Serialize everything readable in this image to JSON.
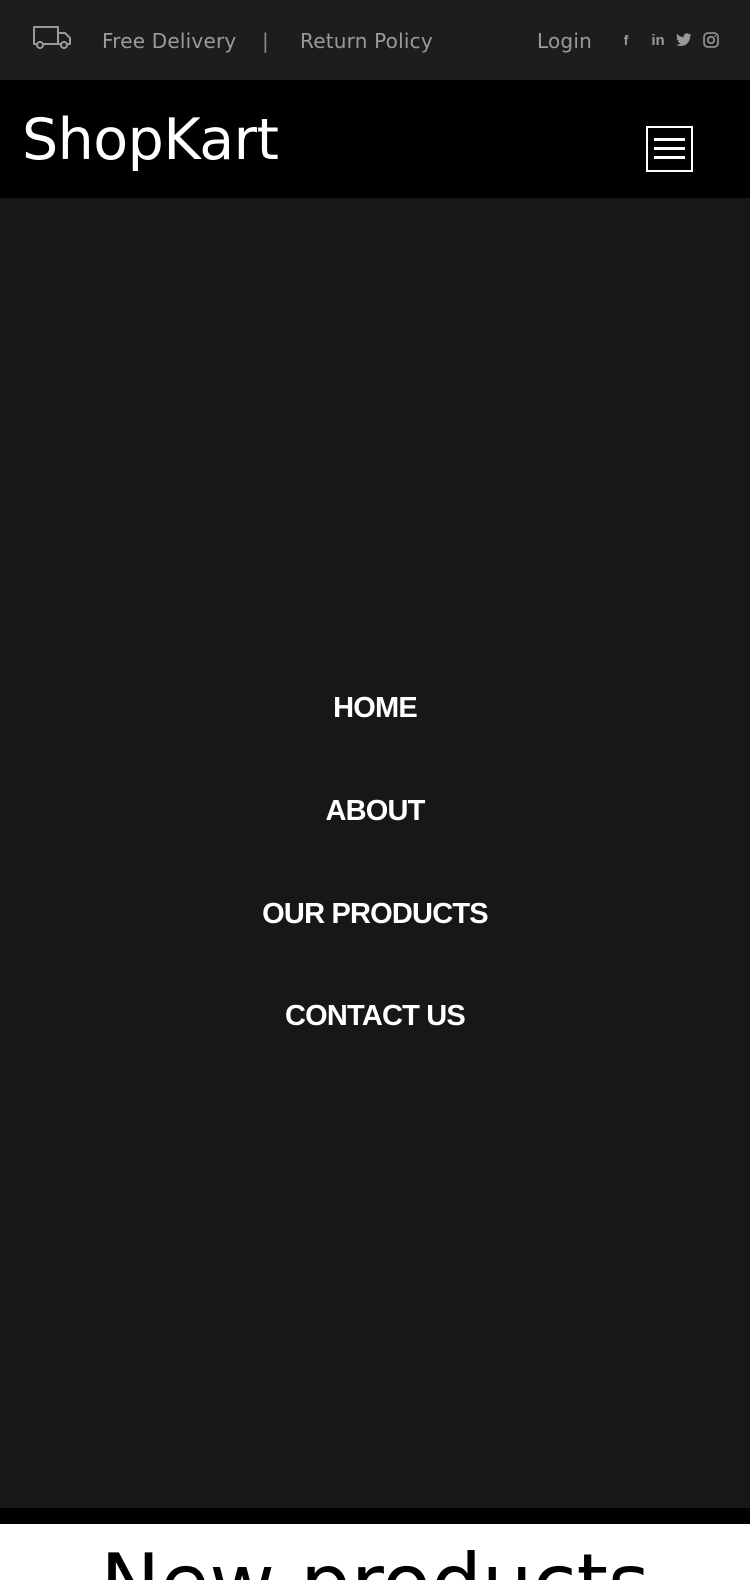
{
  "topbar": {
    "delivery": "Free Delivery",
    "separator": "|",
    "return_policy": "Return Policy",
    "login": "Login",
    "social": {
      "facebook": "f",
      "linkedin": "in"
    }
  },
  "header": {
    "logo": "ShopKart"
  },
  "nav": {
    "items": [
      {
        "label": "HOME"
      },
      {
        "label": "ABOUT"
      },
      {
        "label": "OUR PRODUCTS"
      },
      {
        "label": "CONTACT US"
      }
    ]
  },
  "section": {
    "title": "New products"
  },
  "colors": {
    "topbar_bg": "#1d1d1d",
    "header_bg": "#000000",
    "nav_bg": "#171717",
    "muted_text": "#9a9a9a"
  }
}
